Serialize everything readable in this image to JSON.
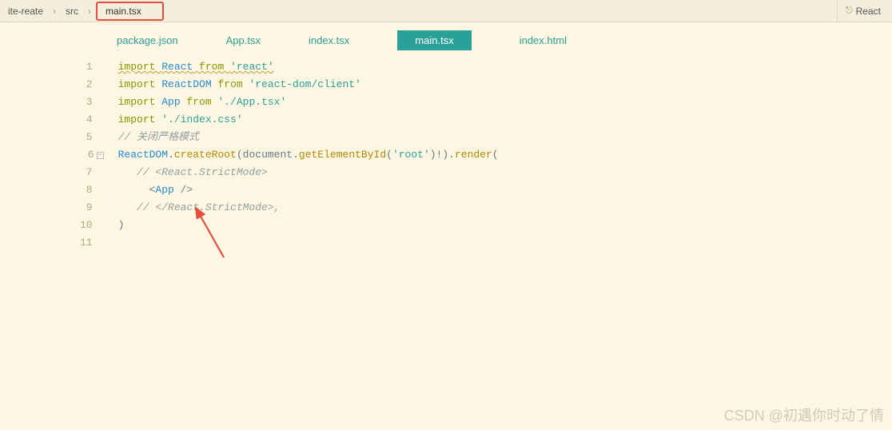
{
  "breadcrumb": {
    "items": [
      "ite-reate",
      "src",
      "main.tsx"
    ],
    "sep": "›"
  },
  "language_indicator": {
    "icon": "⎋",
    "label": "React"
  },
  "tabs": [
    {
      "label": "package.json",
      "active": false
    },
    {
      "label": "App.tsx",
      "active": false
    },
    {
      "label": "index.tsx",
      "active": false
    },
    {
      "label": "main.tsx",
      "active": true
    },
    {
      "label": "index.html",
      "active": false
    }
  ],
  "code": {
    "lines": [
      {
        "n": 1,
        "tok": [
          [
            "kw squiggle",
            "import "
          ],
          [
            "id squiggle",
            "React"
          ],
          [
            "kw squiggle",
            " from "
          ],
          [
            "str squiggle",
            "'react'"
          ]
        ]
      },
      {
        "n": 2,
        "tok": [
          [
            "kw",
            "import "
          ],
          [
            "id",
            "ReactDOM"
          ],
          [
            "kw",
            " from "
          ],
          [
            "str",
            "'react-dom/client'"
          ]
        ]
      },
      {
        "n": 3,
        "tok": [
          [
            "kw",
            "import "
          ],
          [
            "id",
            "App"
          ],
          [
            "kw",
            " from "
          ],
          [
            "str",
            "'./App.tsx'"
          ]
        ]
      },
      {
        "n": 4,
        "tok": [
          [
            "kw",
            "import "
          ],
          [
            "str",
            "'./index.css'"
          ]
        ]
      },
      {
        "n": 5,
        "tok": [
          [
            "cm",
            "// 关闭严格模式"
          ]
        ]
      },
      {
        "n": 6,
        "fold": true,
        "tok": [
          [
            "id",
            "ReactDOM"
          ],
          [
            "pn",
            "."
          ],
          [
            "fn",
            "createRoot"
          ],
          [
            "pn",
            "("
          ],
          [
            "type",
            "document"
          ],
          [
            "pn",
            "."
          ],
          [
            "fn",
            "getElementById"
          ],
          [
            "pn",
            "("
          ],
          [
            "str",
            "'root'"
          ],
          [
            "pn",
            ")!)."
          ],
          [
            "fn",
            "render"
          ],
          [
            "pn",
            "("
          ]
        ]
      },
      {
        "n": 7,
        "tok": [
          [
            "cm",
            "   // <React.StrictMode>"
          ]
        ]
      },
      {
        "n": 8,
        "tok": [
          [
            "pn",
            "     <"
          ],
          [
            "tagc",
            "App"
          ],
          [
            "pn",
            " />"
          ]
        ]
      },
      {
        "n": 9,
        "tok": [
          [
            "cm",
            "   // </React.StrictMode>,"
          ]
        ]
      },
      {
        "n": 10,
        "tok": [
          [
            "pn",
            ")"
          ]
        ]
      },
      {
        "n": 11,
        "tok": []
      }
    ]
  },
  "watermark": "CSDN @初遇你时动了情"
}
